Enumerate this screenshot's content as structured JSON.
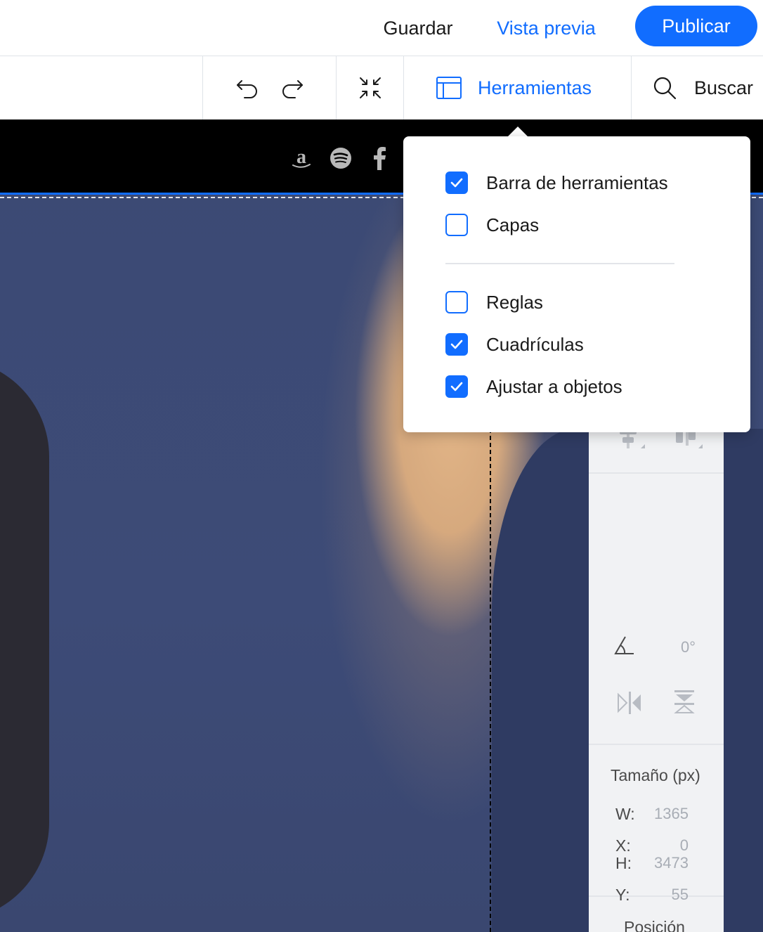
{
  "topbar": {
    "save_label": "Guardar",
    "preview_label": "Vista previa",
    "publish_label": "Publicar"
  },
  "toolbar": {
    "tools_label": "Herramientas",
    "search_label": "Buscar"
  },
  "colors": {
    "accent": "#116dff",
    "header_bg": "#000000",
    "panel_bg": "#f1f2f4"
  },
  "social_icons": [
    "amazon-icon",
    "spotify-icon",
    "facebook-icon"
  ],
  "tools_menu": {
    "group1": [
      {
        "label": "Barra de herramientas",
        "checked": true
      },
      {
        "label": "Capas",
        "checked": false
      }
    ],
    "group2": [
      {
        "label": "Reglas",
        "checked": false
      },
      {
        "label": "Cuadrículas",
        "checked": true
      },
      {
        "label": "Ajustar a objetos",
        "checked": true
      }
    ]
  },
  "inspector": {
    "rotation_value": "0°",
    "size_title": "Tamaño (px)",
    "width_label": "W:",
    "width_value": "1365",
    "height_label": "H:",
    "height_value": "3473",
    "position_title": "Posición",
    "x_label": "X:",
    "x_value": "0",
    "y_label": "Y:",
    "y_value": "55"
  }
}
